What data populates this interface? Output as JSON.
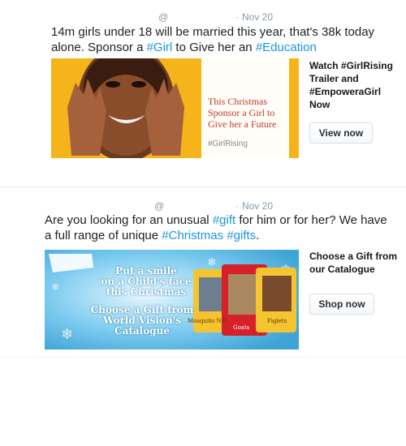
{
  "tweets": [
    {
      "handle": "@",
      "separator": "·",
      "date": "Nov 20",
      "text_parts": [
        {
          "t": "14m girls under 18 will be married this year, that's 38k today alone. Sponsor a "
        },
        {
          "tag": "#Girl"
        },
        {
          "t": " to Give her an "
        },
        {
          "tag": "#Education"
        }
      ],
      "card": {
        "image_text": [
          "This Christmas",
          "Sponsor a Girl to",
          "Give her a Future"
        ],
        "image_hashtag": "#GirlRising",
        "title_lines": [
          "Watch #GirlRising",
          "Trailer and",
          "#EmpoweraGirl",
          "Now"
        ],
        "button": "View now"
      }
    },
    {
      "handle": "@",
      "separator": "·",
      "date": "Nov 20",
      "text_parts": [
        {
          "t": "Are you looking for an unusual "
        },
        {
          "tag": "#gift"
        },
        {
          "t": " for him or for her? We have a full range of unique "
        },
        {
          "tag": "#Christmas"
        },
        {
          "t": " "
        },
        {
          "tag": "#gifts"
        },
        {
          "t": "."
        }
      ],
      "card": {
        "image_text_top": [
          "Put a smile",
          "on a Child's face",
          "this Christmas"
        ],
        "image_text_bottom": [
          "Choose a Gift from",
          "World Vision's",
          "Catalogue"
        ],
        "tags": [
          "Mosquito Net",
          "Goats",
          "Piglets"
        ],
        "title_lines": [
          "Choose a Gift from",
          "our Catalogue"
        ],
        "button": "Shop now"
      }
    }
  ],
  "colors": {
    "link": "#1b95e0",
    "meta": "#8899a6",
    "card1_bg": "#f4b41a",
    "card1_text": "#c0392b",
    "card2_bg": "#5bb8e6",
    "tag_red": "#d6202a",
    "tag_yellow": "#f5c431"
  }
}
